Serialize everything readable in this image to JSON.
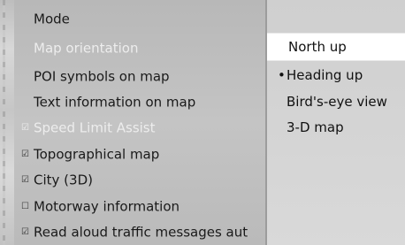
{
  "menu": {
    "items": [
      {
        "label": "Mode",
        "checkbox": ""
      },
      {
        "label": "Map orientation",
        "checkbox": ""
      },
      {
        "label": "POI symbols on map",
        "checkbox": ""
      },
      {
        "label": "Text information on map",
        "checkbox": ""
      },
      {
        "label": "Speed Limit Assist",
        "checkbox": "☑"
      },
      {
        "label": "Topographical map",
        "checkbox": "☑"
      },
      {
        "label": "City (3D)",
        "checkbox": "☑"
      },
      {
        "label": "Motorway information",
        "checkbox": "☐"
      },
      {
        "label": "Read aloud traffic messages aut",
        "checkbox": "☑"
      }
    ]
  },
  "submenu": {
    "items": [
      {
        "label": "North up",
        "bullet": ""
      },
      {
        "label": "Heading up",
        "bullet": "•"
      },
      {
        "label": "Bird's-eye view",
        "bullet": ""
      },
      {
        "label": "3-D map",
        "bullet": ""
      }
    ]
  }
}
